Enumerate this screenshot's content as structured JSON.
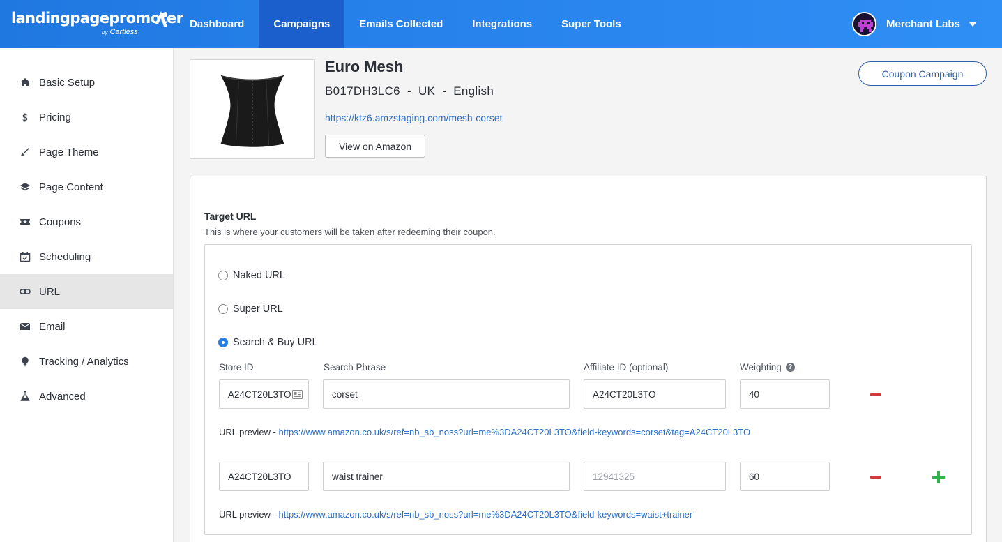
{
  "brand": {
    "name": "landingpagepromoter",
    "by": "by",
    "sub": "Cartless"
  },
  "nav": [
    {
      "label": "Dashboard"
    },
    {
      "label": "Campaigns",
      "active": true
    },
    {
      "label": "Emails Collected"
    },
    {
      "label": "Integrations"
    },
    {
      "label": "Super Tools"
    }
  ],
  "account": {
    "name": "Merchant Labs"
  },
  "sidebar": [
    {
      "label": "Basic Setup",
      "icon": "home-icon"
    },
    {
      "label": "Pricing",
      "icon": "dollar-icon"
    },
    {
      "label": "Page Theme",
      "icon": "brush-icon"
    },
    {
      "label": "Page Content",
      "icon": "layers-icon"
    },
    {
      "label": "Coupons",
      "icon": "ticket-icon"
    },
    {
      "label": "Scheduling",
      "icon": "calendar-icon"
    },
    {
      "label": "URL",
      "icon": "link-icon",
      "active": true
    },
    {
      "label": "Email",
      "icon": "envelope-icon"
    },
    {
      "label": "Tracking / Analytics",
      "icon": "lightbulb-icon"
    },
    {
      "label": "Advanced",
      "icon": "flask-icon"
    }
  ],
  "product": {
    "title": "Euro Mesh",
    "meta": "B017DH3LC6  -  UK  -  English",
    "link": "https://ktz6.amzstaging.com/mesh-corset",
    "view_button": "View on Amazon",
    "campaign_button": "Coupon Campaign"
  },
  "target": {
    "title": "Target URL",
    "description": "This is where your customers will be taken after redeeming their coupon.",
    "options": [
      {
        "label": "Naked URL",
        "checked": false
      },
      {
        "label": "Super URL",
        "checked": false
      },
      {
        "label": "Search & Buy URL",
        "checked": true
      }
    ],
    "columns": {
      "store_id": "Store ID",
      "search_phrase": "Search Phrase",
      "affiliate_id": "Affiliate ID (optional)",
      "weighting": "Weighting"
    },
    "rows": [
      {
        "store_id": "A24CT20L3TO",
        "search_phrase": "corset",
        "affiliate_id": "A24CT20L3TO",
        "affiliate_placeholder": false,
        "weighting": "40",
        "preview_label": "URL preview - ",
        "preview_url": "https://www.amazon.co.uk/s/ref=nb_sb_noss?url=me%3DA24CT20L3TO&field-keywords=corset&tag=A24CT20L3TO"
      },
      {
        "store_id": "A24CT20L3TO",
        "search_phrase": "waist trainer",
        "affiliate_id": "12941325",
        "affiliate_placeholder": true,
        "weighting": "60",
        "preview_label": "URL preview - ",
        "preview_url": "https://www.amazon.co.uk/s/ref=nb_sb_noss?url=me%3DA24CT20L3TO&field-keywords=waist+trainer"
      }
    ]
  },
  "colors": {
    "header_gradient_start": "#1f78e0",
    "nav_active": "#1a5fcc",
    "link": "#2a6fc9",
    "remove": "#d23b3b",
    "add": "#2fb44c"
  }
}
